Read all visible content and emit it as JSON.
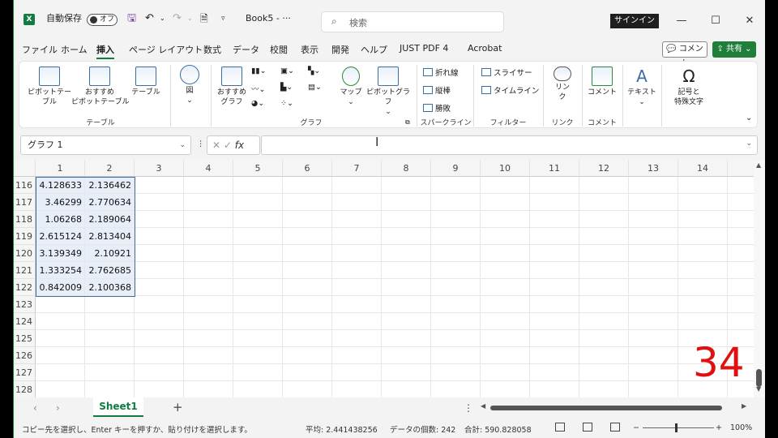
{
  "titlebar": {
    "autosave_label": "自動保存",
    "autosave_state": "オフ",
    "filename": "Book5 - ···",
    "search_placeholder": "検索",
    "signin_label": "サインイン",
    "minimize": "—",
    "maximize": "☐",
    "close": "✕"
  },
  "menu": {
    "tabs": [
      "ファイル",
      "ホーム",
      "挿入",
      "ページ レイアウト",
      "数式",
      "データ",
      "校閲",
      "表示",
      "開発",
      "ヘルプ",
      "JUST PDF 4",
      "Acrobat"
    ],
    "active": "挿入",
    "comment_button": "コメント",
    "share_button": "共有"
  },
  "ribbon": {
    "pivot_table": "ピボットテー\nブル",
    "recommended_pivot": "おすすめ\nピボットテーブル",
    "table": "テーブル",
    "group_table": "テーブル",
    "illustration": "図",
    "recommended_chart": "おすすめ\nグラフ",
    "map": "マップ",
    "pivot_chart": "ピボットグラフ",
    "group_chart": "グラフ",
    "sparkline_line": "折れ線",
    "sparkline_column": "縦棒",
    "sparkline_winloss": "勝敗",
    "group_sparkline": "スパークライン",
    "slicer": "スライサー",
    "timeline": "タイムライン",
    "group_filter": "フィルター",
    "link": "リン\nク",
    "group_link": "リンク",
    "comment": "コメント",
    "group_comment": "コメント",
    "text": "テキスト",
    "symbol": "記号と\n特殊文字"
  },
  "formula_bar": {
    "name_box": "グラフ 1",
    "fx": "fx",
    "content": ""
  },
  "grid": {
    "columns": [
      "1",
      "2",
      "3",
      "4",
      "5",
      "6",
      "7",
      "8",
      "9",
      "10",
      "11",
      "12",
      "13",
      "14"
    ],
    "rows": [
      {
        "num": "116",
        "c1": "4.128633",
        "c2": "2.136462"
      },
      {
        "num": "117",
        "c1": "3.46299",
        "c2": "2.770634"
      },
      {
        "num": "118",
        "c1": "1.06268",
        "c2": "2.189064"
      },
      {
        "num": "119",
        "c1": "2.615124",
        "c2": "2.813404"
      },
      {
        "num": "120",
        "c1": "3.139349",
        "c2": "2.10921"
      },
      {
        "num": "121",
        "c1": "1.333254",
        "c2": "2.762685"
      },
      {
        "num": "122",
        "c1": "0.842009",
        "c2": "2.100368"
      },
      {
        "num": "123",
        "c1": "",
        "c2": ""
      },
      {
        "num": "124",
        "c1": "",
        "c2": ""
      },
      {
        "num": "125",
        "c1": "",
        "c2": ""
      },
      {
        "num": "126",
        "c1": "",
        "c2": ""
      },
      {
        "num": "127",
        "c1": "",
        "c2": ""
      },
      {
        "num": "128",
        "c1": "",
        "c2": ""
      }
    ]
  },
  "overlay_number": "34",
  "sheets": {
    "tabs": [
      "Sheet1"
    ],
    "add": "+"
  },
  "status": {
    "message": "コピー先を選択し、Enter キーを押すか、貼り付けを選択します。",
    "average": "平均: 2.441438256",
    "count": "データの個数: 242",
    "sum": "合計: 590.828058",
    "zoom": "100%",
    "zoom_minus": "−",
    "zoom_plus": "+"
  },
  "colors": {
    "excel_green": "#107c41",
    "overlay_red": "#e01010",
    "selection_border": "#3b6ea5"
  }
}
